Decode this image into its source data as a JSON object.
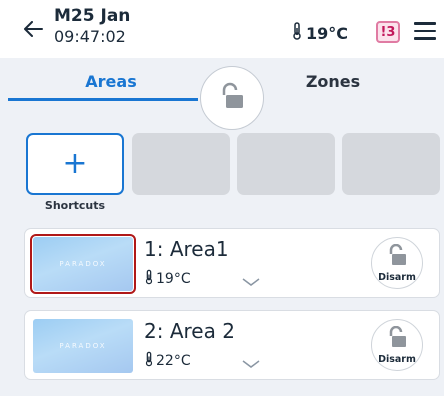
{
  "header": {
    "date": "M25 Jan",
    "time": "09:47:02",
    "temperature": "19°C",
    "notification_badge": "!3"
  },
  "tabs": [
    {
      "label": "Areas",
      "active": true
    },
    {
      "label": "Zones",
      "active": false
    }
  ],
  "shortcuts": {
    "label": "Shortcuts",
    "add_symbol": "+"
  },
  "thumbnail_logo": "PARADOX",
  "areas": [
    {
      "name": "1: Area1",
      "temperature": "19°C",
      "action": "Disarm",
      "selected": true
    },
    {
      "name": "2: Area 2",
      "temperature": "22°C",
      "action": "Disarm",
      "selected": false
    }
  ],
  "colors": {
    "accent": "#1976d2",
    "background": "#eef1f6",
    "badge": "#e07ba3",
    "selection": "#b01818"
  },
  "icons": [
    "back-arrow-icon",
    "thermometer-icon",
    "menu-icon",
    "unlocked-padlock-icon",
    "chevron-down-icon",
    "plus-icon"
  ]
}
